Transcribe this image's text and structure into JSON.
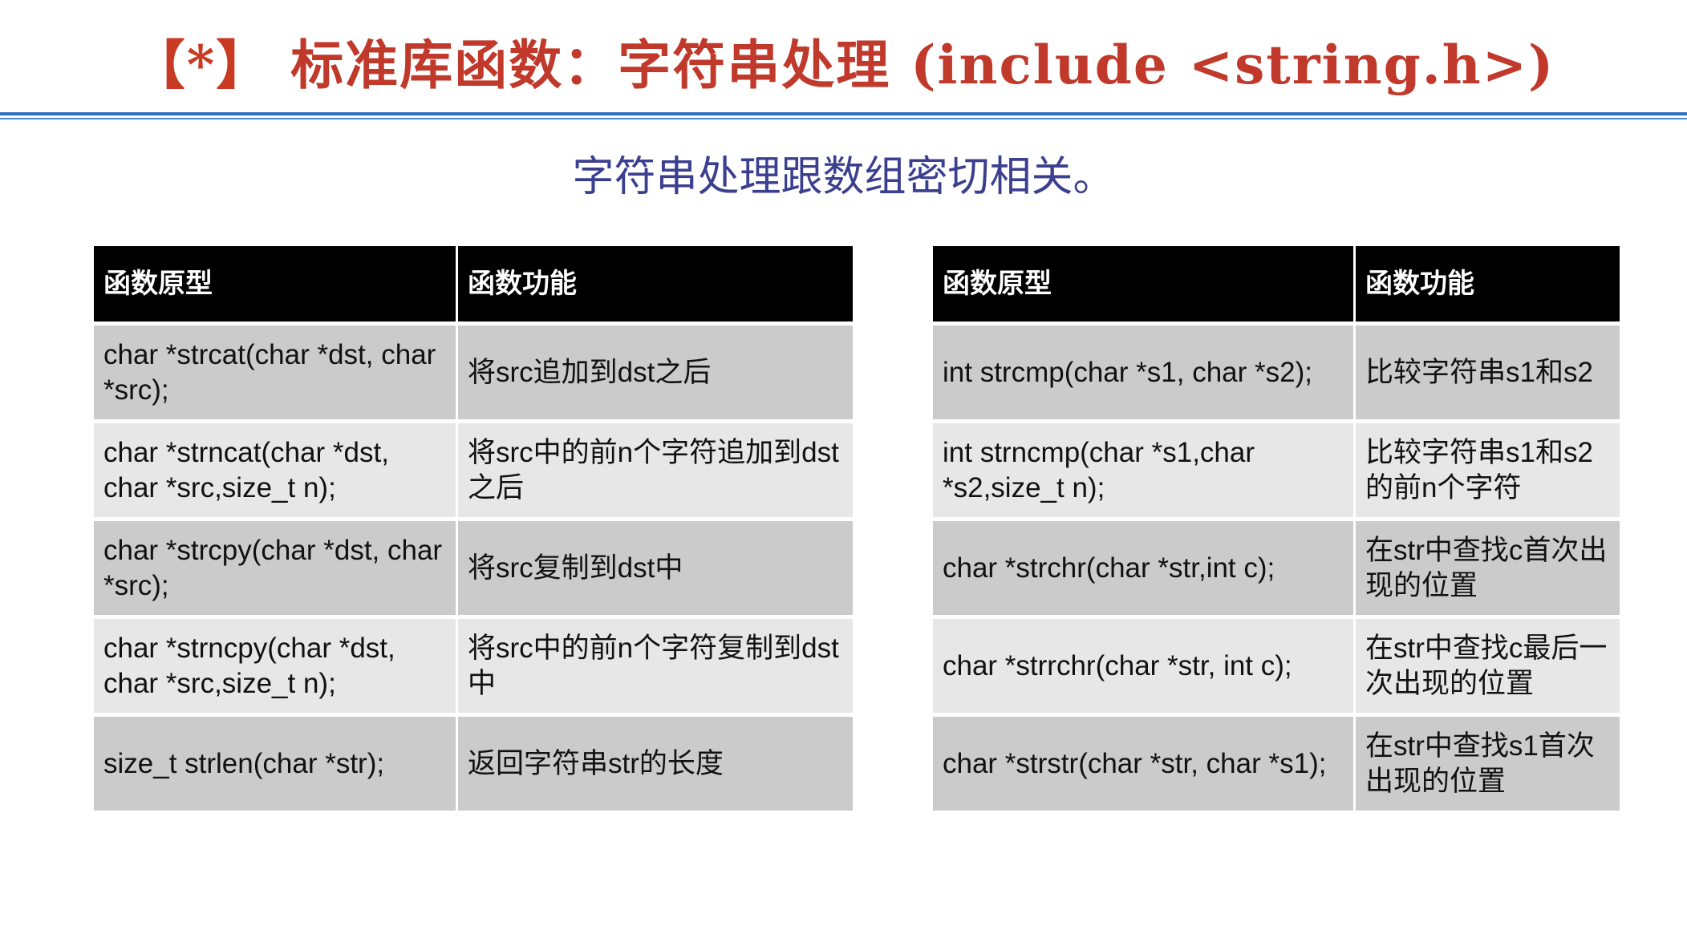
{
  "title": {
    "bracket": "【*】",
    "text": "标准库函数：字符串处理 (include <string.h>)"
  },
  "subtitle": "字符串处理跟数组密切相关。",
  "tables": [
    {
      "headers": [
        "函数原型",
        "函数功能"
      ],
      "rows": [
        [
          "char *strcat(char *dst, char *src);",
          "将src追加到dst之后"
        ],
        [
          "char *strncat(char *dst, char *src,size_t n);",
          "将src中的前n个字符追加到dst之后"
        ],
        [
          "char *strcpy(char *dst, char *src);",
          "将src复制到dst中"
        ],
        [
          "char *strncpy(char *dst, char *src,size_t n);",
          "将src中的前n个字符复制到dst中"
        ],
        [
          "size_t strlen(char *str);",
          "返回字符串str的长度"
        ]
      ]
    },
    {
      "headers": [
        "函数原型",
        "函数功能"
      ],
      "rows": [
        [
          "int strcmp(char *s1, char *s2);",
          "比较字符串s1和s2"
        ],
        [
          "int strncmp(char *s1,char *s2,size_t n);",
          "比较字符串s1和s2的前n个字符"
        ],
        [
          "char *strchr(char *str,int c);",
          "在str中查找c首次出现的位置"
        ],
        [
          "char *strrchr(char *str, int c);",
          "在str中查找c最后一次出现的位置"
        ],
        [
          "char *strstr(char *str, char *s1);",
          "在str中查找s1首次出现的位置"
        ]
      ]
    }
  ]
}
